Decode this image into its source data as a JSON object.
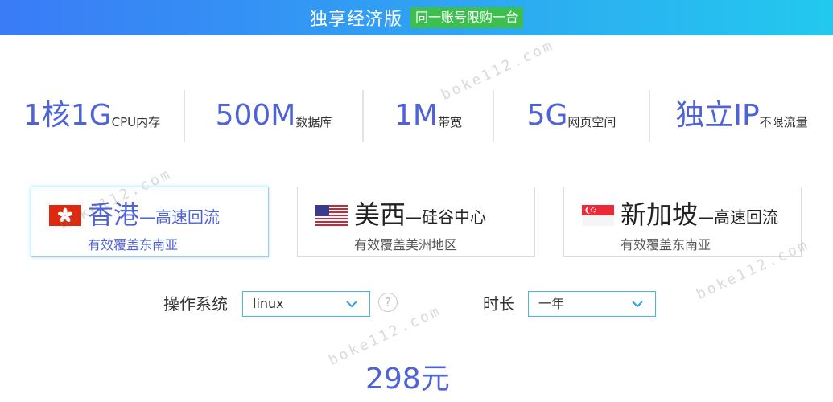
{
  "banner": {
    "title": "独享经济版",
    "badge": "同一账号限购一台",
    "colors": {
      "start": "#3a7bf6",
      "end": "#22c9ee",
      "badge": "#3dbf4f"
    }
  },
  "specs": [
    {
      "value": "1核1G",
      "unit": "CPU内存"
    },
    {
      "value": "500M",
      "unit": "数据库"
    },
    {
      "value": "1M",
      "unit": "带宽"
    },
    {
      "value": "5G",
      "unit": "网页空间"
    },
    {
      "value": "独立IP",
      "unit": "不限流量"
    }
  ],
  "regions": [
    {
      "name": "香港",
      "sub": "—高速回流",
      "desc": "有效覆盖东南亚",
      "flag": "hong-kong-flag-icon",
      "selected": true
    },
    {
      "name": "美西",
      "sub": "—硅谷中心",
      "desc": "有效覆盖美洲地区",
      "flag": "us-flag-icon",
      "selected": false
    },
    {
      "name": "新加坡",
      "sub": "—高速回流",
      "desc": "有效覆盖东南亚",
      "flag": "singapore-flag-icon",
      "selected": false
    }
  ],
  "os": {
    "label": "操作系统",
    "value": "linux"
  },
  "duration": {
    "label": "时长",
    "value": "一年"
  },
  "help_icon": {
    "glyph": "?",
    "icon": "question-circle-icon"
  },
  "price": {
    "text": "298元"
  },
  "watermark": {
    "text": "boke112.com"
  },
  "theme": {
    "accent": "#4f63d8",
    "select_border": "#46b8d8"
  }
}
